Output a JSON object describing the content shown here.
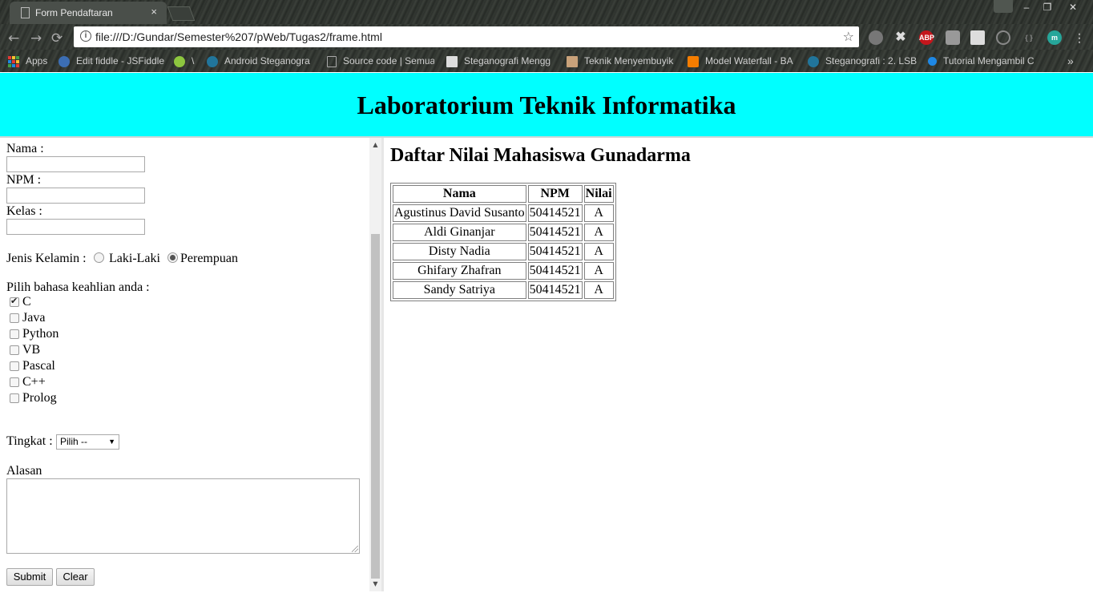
{
  "browser": {
    "tab_title": "Form Pendaftaran",
    "tab_close": "×",
    "url": "file:///D:/Gundar/Semester%207/pWeb/Tugas2/frame.html",
    "window_controls": [
      "–",
      "❐",
      "✕"
    ],
    "bookmarks": [
      {
        "label": "Apps",
        "icon": "apps-grid-icon"
      },
      {
        "label": "Edit fiddle - JSFiddle",
        "icon": "jsfiddle-icon",
        "color": "#3c6eb4"
      },
      {
        "label": "\\",
        "icon": "m-green-icon",
        "color": "#8dc63f"
      },
      {
        "label": "Android Steganogra",
        "icon": "wordpress-icon",
        "color": "#21759b"
      },
      {
        "label": "Source code | Semua",
        "icon": "page-icon"
      },
      {
        "label": "Steganografi Mengg",
        "icon": "dot-grid-icon"
      },
      {
        "label": "Teknik Menyembuyik",
        "icon": "thumbnail-icon"
      },
      {
        "label": "Model Waterfall - BA",
        "icon": "blogger-icon",
        "color": "#f57d00"
      },
      {
        "label": "Steganografi : 2. LSB",
        "icon": "wordpress-icon",
        "color": "#21759b"
      },
      {
        "label": "Tutorial Mengambil C",
        "icon": "blue-dot-icon",
        "color": "#1e88e5"
      }
    ],
    "more": "»"
  },
  "header": {
    "title": "Laboratorium Teknik Informatika"
  },
  "form": {
    "nama_label": "Nama :",
    "npm_label": "NPM :",
    "kelas_label": "Kelas :",
    "gender_label": "Jenis Kelamin :",
    "gender_options": [
      "Laki-Laki",
      "Perempuan"
    ],
    "gender_selected": "Perempuan",
    "lang_label": "Pilih bahasa keahlian anda :",
    "languages": [
      {
        "label": "C",
        "checked": true
      },
      {
        "label": "Java",
        "checked": false
      },
      {
        "label": "Python",
        "checked": false
      },
      {
        "label": "VB",
        "checked": false
      },
      {
        "label": "Pascal",
        "checked": false
      },
      {
        "label": "C++",
        "checked": false
      },
      {
        "label": "Prolog",
        "checked": false
      }
    ],
    "tingkat_label": "Tingkat :",
    "tingkat_value": "Pilih --",
    "alasan_label": "Alasan",
    "submit_label": "Submit",
    "clear_label": "Clear"
  },
  "grades": {
    "title": "Daftar Nilai Mahasiswa Gunadarma",
    "headers": [
      "Nama",
      "NPM",
      "Nilai"
    ],
    "rows": [
      [
        "Agustinus David Susanto",
        "50414521",
        "A"
      ],
      [
        "Aldi Ginanjar",
        "50414521",
        "A"
      ],
      [
        "Disty Nadia",
        "50414521",
        "A"
      ],
      [
        "Ghifary Zhafran",
        "50414521",
        "A"
      ],
      [
        "Sandy Satriya",
        "50414521",
        "A"
      ]
    ]
  }
}
